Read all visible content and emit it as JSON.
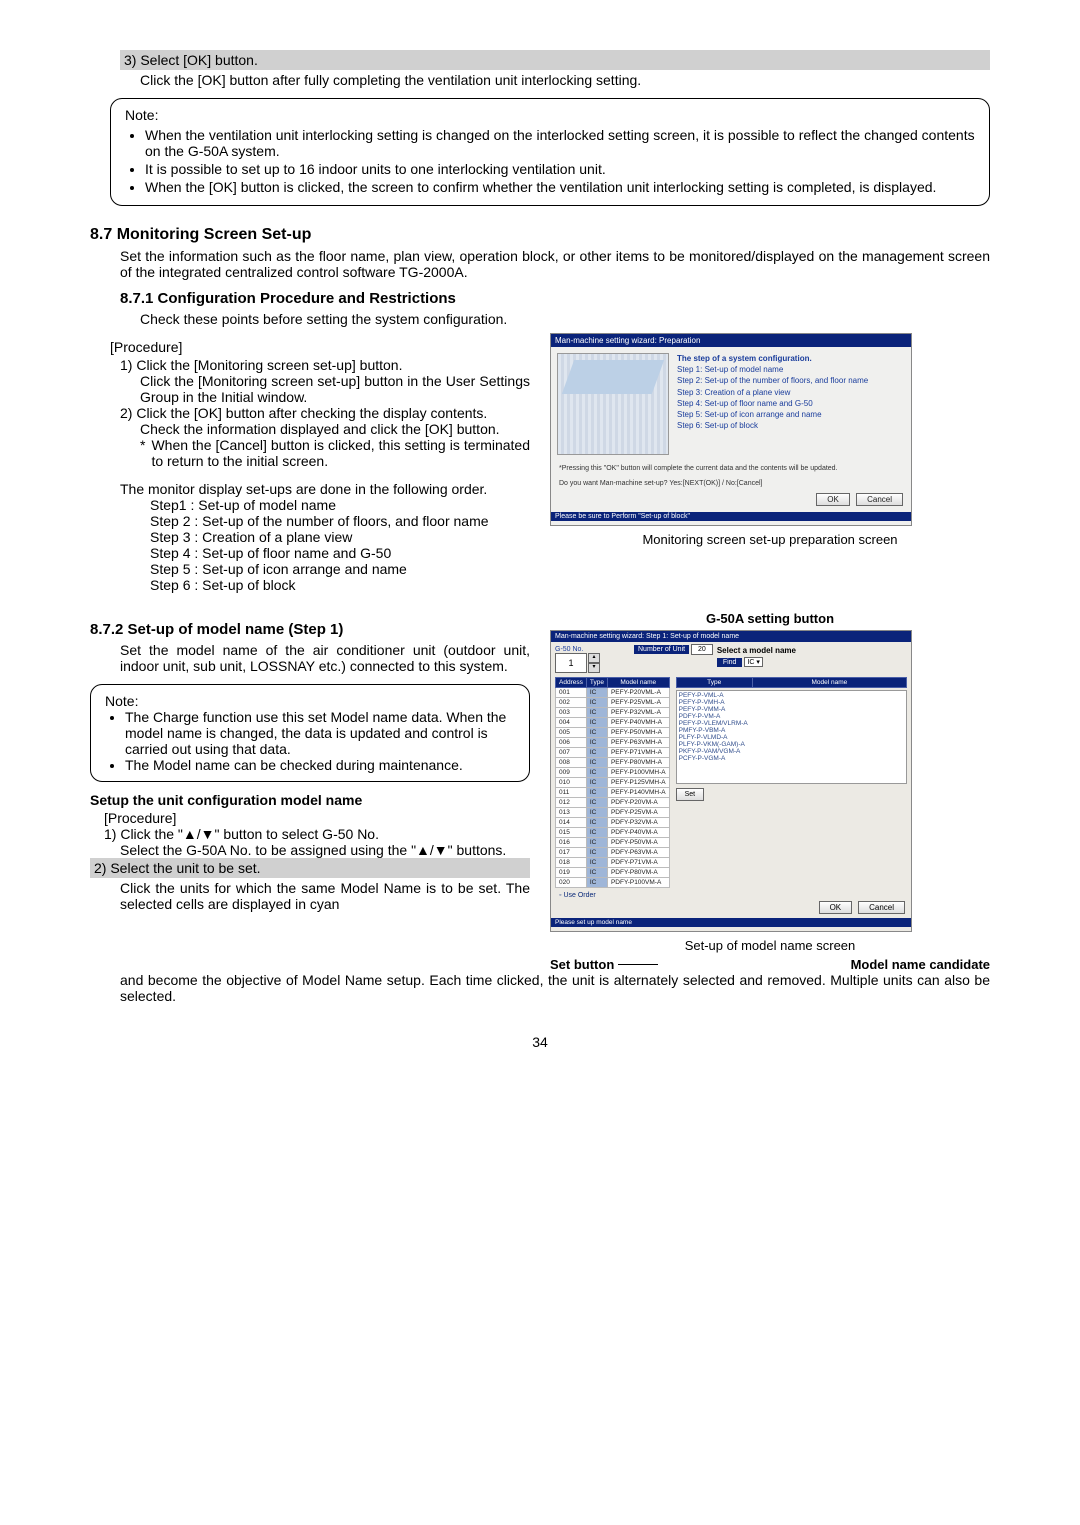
{
  "top": {
    "step3_gray": "3) Select [OK] button.",
    "step3_desc": "Click the [OK] button after fully completing the ventilation unit interlocking setting.",
    "note_title": "Note:",
    "note_items": [
      "When the ventilation unit interlocking setting is changed on the interlocked setting screen, it is possible to reflect the changed contents on the G-50A system.",
      "It is possible to set up to 16 indoor units to one interlocking ventilation unit.",
      "When the [OK] button is clicked, the screen to confirm whether the ventilation unit interlocking setting is completed, is displayed."
    ]
  },
  "s87": {
    "heading": "8.7   Monitoring Screen Set-up",
    "para": "Set the information such as the floor name, plan view, operation block, or other items to be monitored/displayed on the management screen of the integrated centralized control software TG-2000A."
  },
  "s871": {
    "heading": "8.7.1 Configuration Procedure and Restrictions",
    "intro": "Check these points before setting the system configuration.",
    "procedure_label": "[Procedure]",
    "p1_head": "1) Click the [Monitoring screen set-up] button.",
    "p1_body": "Click the [Monitoring screen set-up] button in the User Settings Group in the Initial window.",
    "p2_head": "2) Click the [OK] button after checking the display contents.",
    "p2_body": "Check the information displayed and click the  [OK] button.",
    "p2_star": "When the [Cancel] button is clicked, this setting is terminated to return to the initial screen.",
    "order_para": "The monitor display set-ups are done in the following order.",
    "steps": {
      "s1": "Step1 : Set-up of model name",
      "s2": "Step 2 : Set-up of the number of floors, and floor name",
      "s3": "Step 3 : Creation of a plane view",
      "s4": "Step 4 : Set-up of floor name and G-50",
      "s5": "Step 5 : Set-up of icon arrange and name",
      "s6": "Step 6 : Set-up of block"
    },
    "caption": "Monitoring screen set-up preparation screen"
  },
  "shot1": {
    "titlebar": "Man-machine setting wizard: Preparation",
    "steps_header": "The step of a system configuration.",
    "step1": "Step 1: Set-up of model name",
    "step2": "Step 2: Set-up of the number of floors, and floor name",
    "step3": "Step 3: Creation of a plane view",
    "step4": "Step 4: Set-up of floor name and G-50",
    "step5": "Step 5: Set-up of icon arrange and name",
    "step6": "Step 6: Set-up of block",
    "warn": "*Pressing this \"OK\" button will complete the current data and the contents will be updated.",
    "prompt": "Do you want Man-machine set-up? Yes:[NEXT(OK)] / No:[Cancel]",
    "ok": "OK",
    "cancel": "Cancel",
    "status": "Please be sure to Perform \"Set-up of block\""
  },
  "s872": {
    "heading": "8.7.2 Set-up of model name (Step 1)",
    "intro": "Set the model name of the air conditioner unit (outdoor unit, indoor unit, sub unit, LOSSNAY etc.) connected to this system.",
    "note_title": "Note:",
    "note_items": [
      "The Charge function use this set Model name data. When the model name is changed, the data is updated and control is carried out using that data.",
      "The Model name can be checked during maintenance."
    ],
    "setup_title": "Setup the unit configuration model name",
    "procedure_label": "[Procedure]",
    "p1_head": "1) Click the \"▲/▼\" button to select G-50  No.",
    "p1_body": "Select the  G-50A No. to be assigned using the \"▲/▼\" buttons.",
    "p2_head_gray": "2) Select the unit to be set.",
    "p2_body": "Click the units for which the same Model Name is to be set. The selected cells are displayed in cyan and become the objective of Model Name setup. Each time clicked, the unit is alternately selected and removed. Multiple units can also be selected.",
    "g50_caption": "G-50A setting button",
    "caption": "Set-up of model name screen",
    "set_button_label": "Set button",
    "model_name_cand": "Model name candidate"
  },
  "shot2": {
    "titlebar": "Man-machine setting wizard: Step 1: Set-up of model name",
    "g50_label": "G-50 No.",
    "g50_value": "1",
    "numunit": "Number of Unit",
    "numunit_val": "20",
    "select_label": "Select a model name",
    "find": "Find",
    "ic_label": "IC",
    "col_addr": "Address",
    "col_type": "Type",
    "col_model": "Model name",
    "col_type2": "Type",
    "col_mname": "Model name",
    "rows": [
      {
        "a": "001",
        "t": "IC",
        "m": "PEFY-P20VML-A"
      },
      {
        "a": "002",
        "t": "IC",
        "m": "PEFY-P25VML-A"
      },
      {
        "a": "003",
        "t": "IC",
        "m": "PEFY-P32VML-A"
      },
      {
        "a": "004",
        "t": "IC",
        "m": "PEFY-P40VMH-A"
      },
      {
        "a": "005",
        "t": "IC",
        "m": "PEFY-P50VMH-A"
      },
      {
        "a": "006",
        "t": "IC",
        "m": "PEFY-P63VMH-A"
      },
      {
        "a": "007",
        "t": "IC",
        "m": "PEFY-P71VMH-A"
      },
      {
        "a": "008",
        "t": "IC",
        "m": "PEFY-P80VMH-A"
      },
      {
        "a": "009",
        "t": "IC",
        "m": "PEFY-P100VMH-A"
      },
      {
        "a": "010",
        "t": "IC",
        "m": "PEFY-P125VMH-A"
      },
      {
        "a": "011",
        "t": "IC",
        "m": "PEFY-P140VMH-A"
      },
      {
        "a": "012",
        "t": "IC",
        "m": "PDFY-P20VM-A"
      },
      {
        "a": "013",
        "t": "IC",
        "m": "PDFY-P25VM-A"
      },
      {
        "a": "014",
        "t": "IC",
        "m": "PDFY-P32VM-A"
      },
      {
        "a": "015",
        "t": "IC",
        "m": "PDFY-P40VM-A"
      },
      {
        "a": "016",
        "t": "IC",
        "m": "PDFY-P50VM-A"
      },
      {
        "a": "017",
        "t": "IC",
        "m": "PDFY-P63VM-A"
      },
      {
        "a": "018",
        "t": "IC",
        "m": "PDFY-P71VM-A"
      },
      {
        "a": "019",
        "t": "IC",
        "m": "PDFY-P80VM-A"
      },
      {
        "a": "020",
        "t": "IC",
        "m": "PDFY-P100VM-A"
      }
    ],
    "types": [
      "PEFY-P-VML-A",
      "PEFY-P-VMH-A",
      "PEFY-P-VMM-A",
      "PDFY-P-VM-A",
      "PEFY-P-VLEM/VLRM-A",
      "PMFY-P-VBM-A",
      "PLFY-P-VLMD-A",
      "PLFY-P-VKM(-GAM)-A",
      "PKFY-P-VAM/VGM-A",
      "PCFY-P-VGM-A"
    ],
    "set": "Set",
    "radio": "Use Order",
    "ok": "OK",
    "cancel": "Cancel",
    "status": "Please set up model name"
  },
  "page": "34"
}
